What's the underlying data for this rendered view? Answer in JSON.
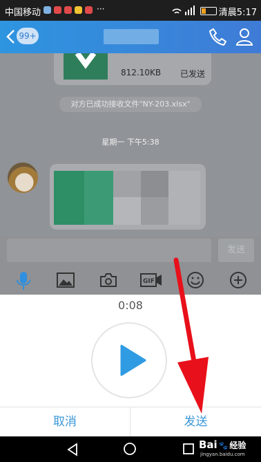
{
  "status_bar": {
    "carrier": "中国移动",
    "time": "清晨5:17",
    "more": "···"
  },
  "header": {
    "unread_badge": "99+"
  },
  "chat": {
    "file_size": "812.10KB",
    "file_status": "已发送",
    "system_message": "对方已成功接收文件\"NY-203.xlsx\"",
    "timestamp": "星期一 下午5:38"
  },
  "input": {
    "send_label": "发送"
  },
  "voice": {
    "duration": "0:08",
    "cancel_label": "取消",
    "send_label": "发送"
  },
  "watermark": {
    "brand": "Bai",
    "suffix": "经验",
    "url": "jingyan.baidu.com"
  },
  "colors": {
    "accent": "#3a97d8",
    "header": "#2e95e0",
    "arrow": "#e8101a",
    "play": "#2f9be2"
  }
}
